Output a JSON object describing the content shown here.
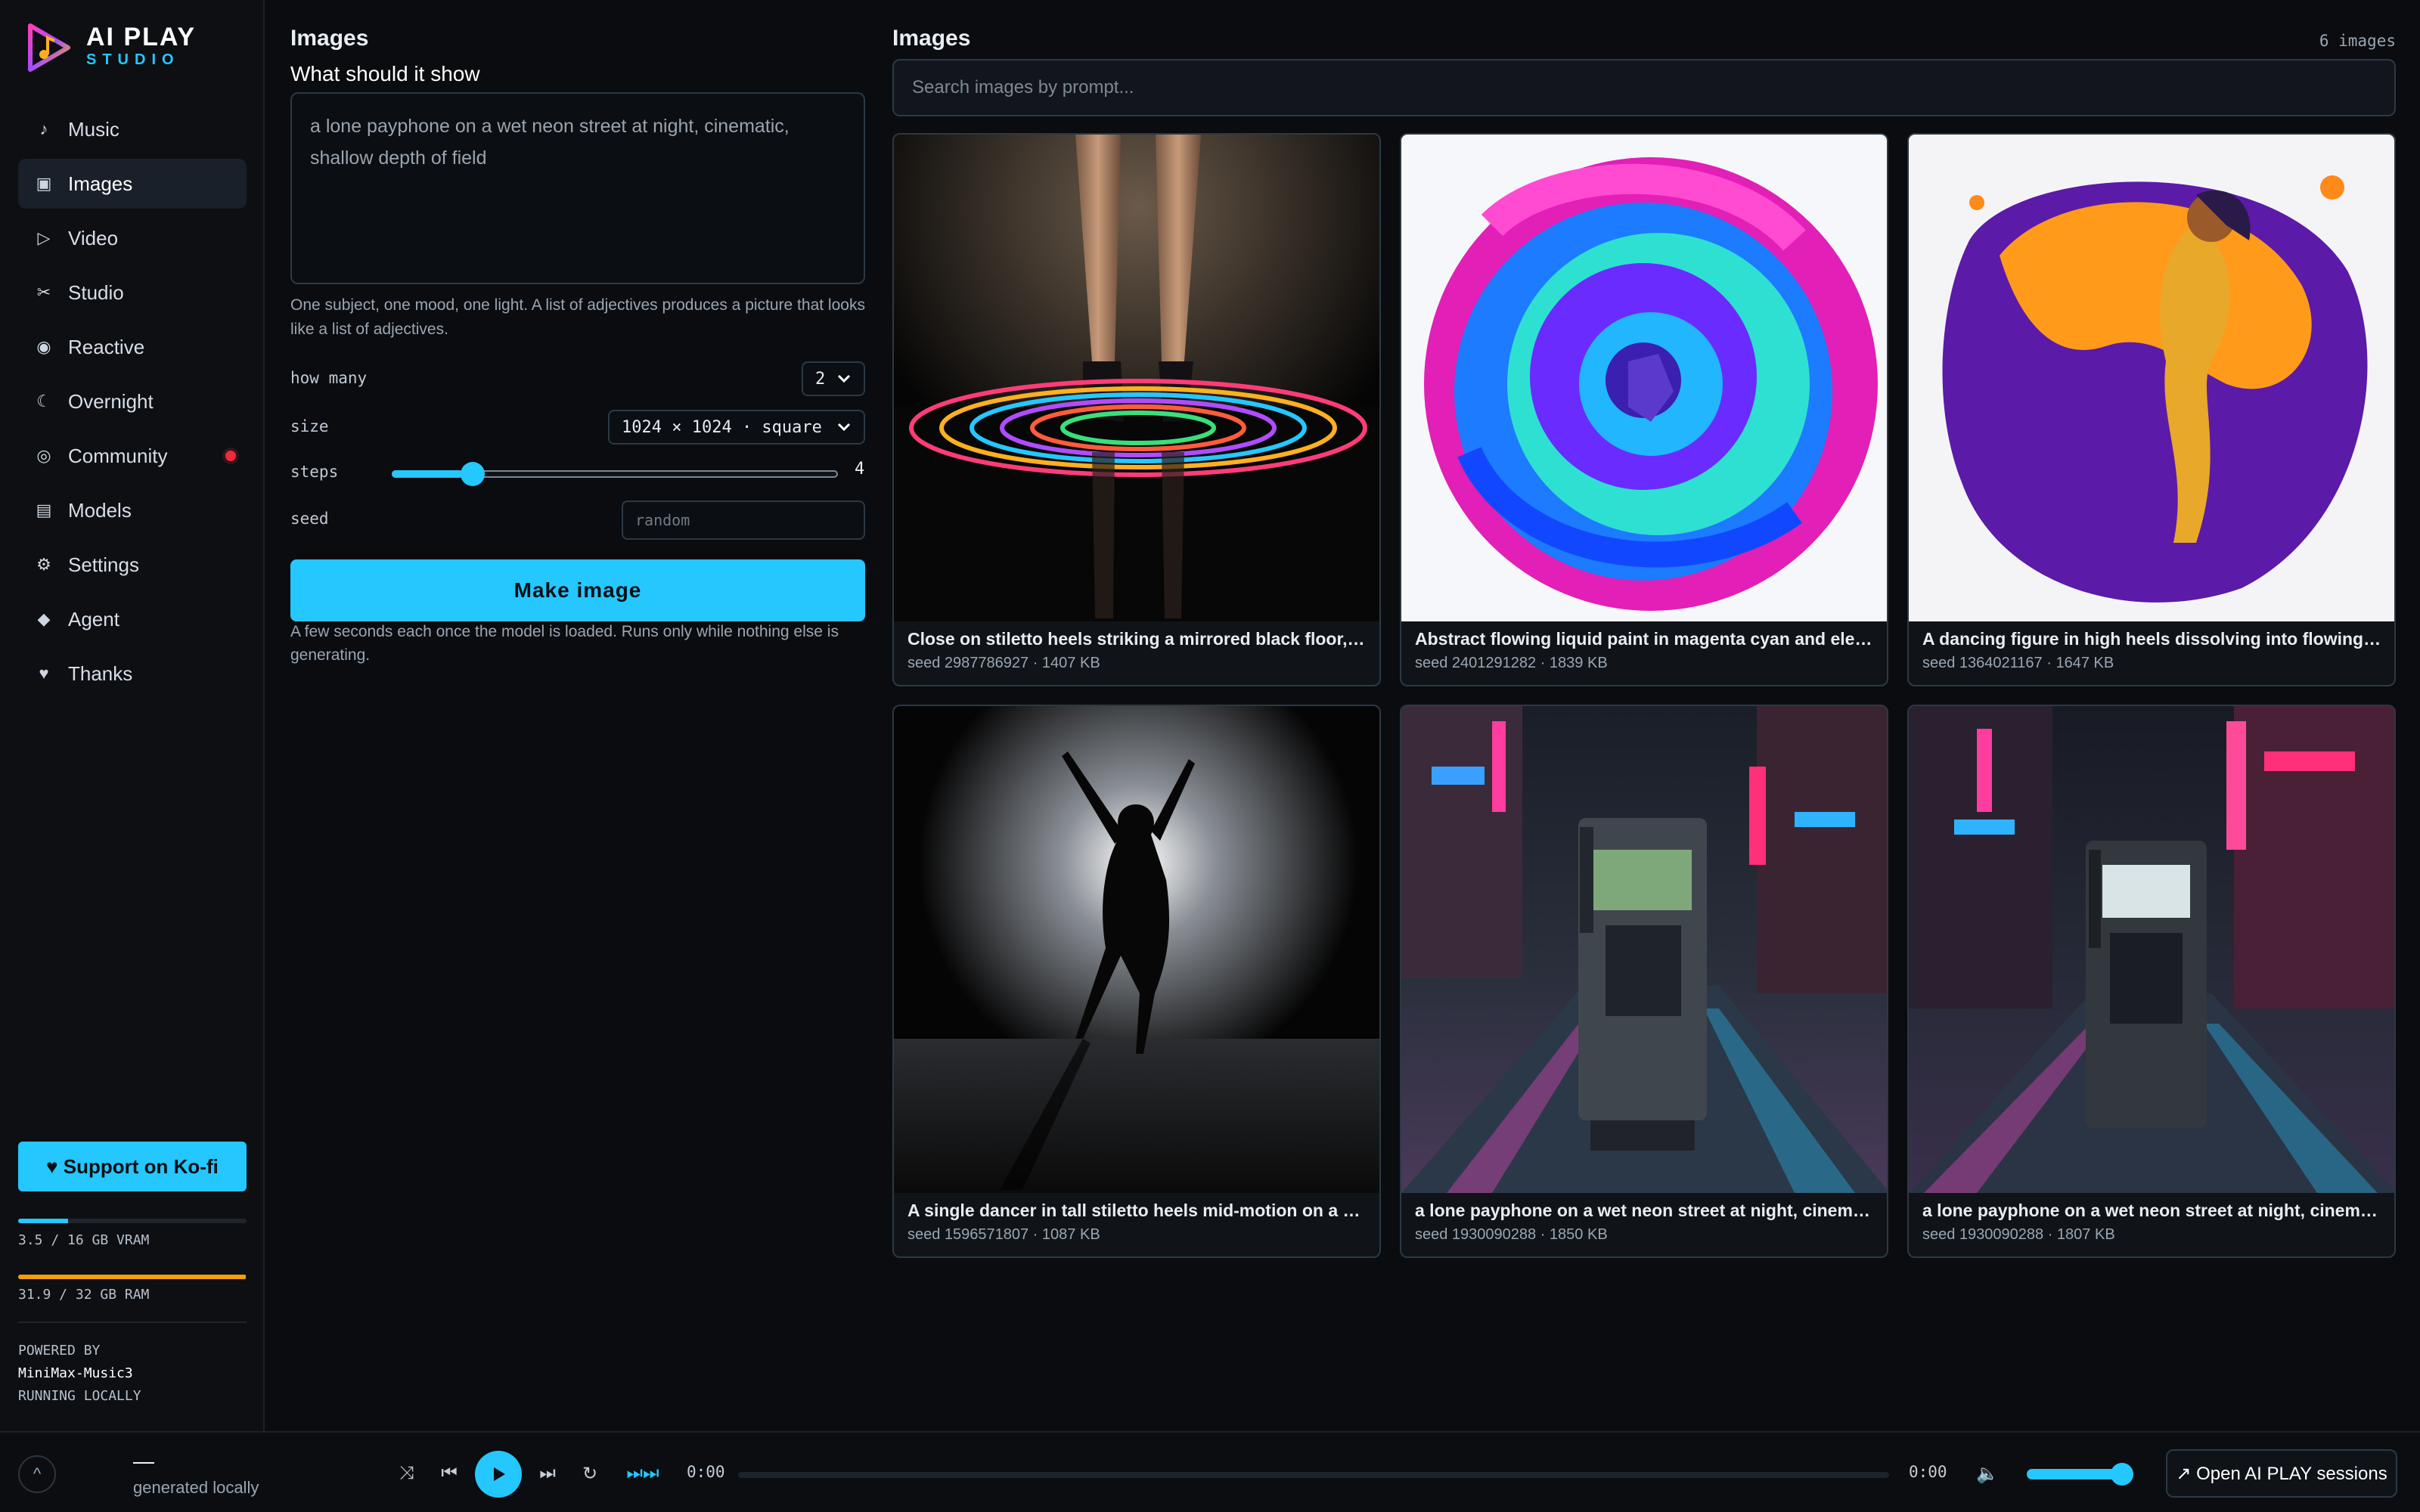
{
  "brand": {
    "title": "AI PLAY",
    "subtitle": "STUDIO"
  },
  "sidebar": {
    "items": [
      {
        "label": "Music",
        "icon": "music-note-icon"
      },
      {
        "label": "Images",
        "icon": "image-icon",
        "active": true
      },
      {
        "label": "Video",
        "icon": "play-outline-icon"
      },
      {
        "label": "Studio",
        "icon": "scissors-icon"
      },
      {
        "label": "Reactive",
        "icon": "target-icon"
      },
      {
        "label": "Overnight",
        "icon": "moon-icon"
      },
      {
        "label": "Community",
        "icon": "community-icon",
        "notification": true
      },
      {
        "label": "Models",
        "icon": "layers-icon"
      },
      {
        "label": "Settings",
        "icon": "gear-icon"
      },
      {
        "label": "Agent",
        "icon": "diamond-icon"
      },
      {
        "label": "Thanks",
        "icon": "heart-icon"
      }
    ],
    "support_label": "♥ Support on Ko-fi",
    "vram": {
      "label": "3.5 / 16 GB VRAM",
      "used": 3.5,
      "total": 16,
      "color": "#25c7ff"
    },
    "ram": {
      "label": "31.9 / 32 GB RAM",
      "used": 31.9,
      "total": 32,
      "color": "#f59e0b"
    },
    "powered_by": "POWERED BY",
    "model": "MiniMax-Music3",
    "running": "RUNNING LOCALLY"
  },
  "form": {
    "title": "Images",
    "question": "What should it show",
    "prompt": "a lone payphone on a wet neon street at night, cinematic, shallow depth of field",
    "hint": "One subject, one mood, one light. A list of adjectives produces a picture that looks like a list of adjectives.",
    "how_many_label": "how many",
    "how_many_value": "2",
    "size_label": "size",
    "size_value": "1024 × 1024 · square",
    "steps_label": "steps",
    "steps_value": "4",
    "steps_min": 1,
    "steps_max": 20,
    "seed_label": "seed",
    "seed_placeholder": "random",
    "make_label": "Make image",
    "make_note": "A few seconds each once the model is loaded. Runs only while nothing else is generating."
  },
  "gallery": {
    "title": "Images",
    "count": "6 images",
    "search_placeholder": "Search images by prompt...",
    "cards": [
      {
        "caption": "Close on stiletto heels striking a mirrored black floor, the i...",
        "meta": "seed 2987786927 · 1407 KB",
        "art": "heels"
      },
      {
        "caption": "Abstract flowing liquid paint in magenta cyan and electric ...",
        "meta": "seed 2401291282 · 1839 KB",
        "art": "swirl"
      },
      {
        "caption": "A dancing figure in high heels dissolving into flowing mar...",
        "meta": "seed 1364021167 · 1647 KB",
        "art": "dancer-gold"
      },
      {
        "caption": "A single dancer in tall stiletto heels mid-motion on a dark ...",
        "meta": "seed 1596571807 · 1087 KB",
        "art": "silhouette"
      },
      {
        "caption": "a lone payphone on a wet neon street at night, cinematic, ...",
        "meta": "seed 1930090288 · 1850 KB",
        "art": "payphone-a"
      },
      {
        "caption": "a lone payphone on a wet neon street at night, cinematic, ...",
        "meta": "seed 1930090288 · 1807 KB",
        "art": "payphone-b"
      }
    ]
  },
  "player": {
    "track_title": "—",
    "track_sub": "generated locally",
    "time_current": "0:00",
    "time_total": "0:00",
    "volume": 0.9,
    "open_label": "↗ Open AI PLAY sessions"
  }
}
